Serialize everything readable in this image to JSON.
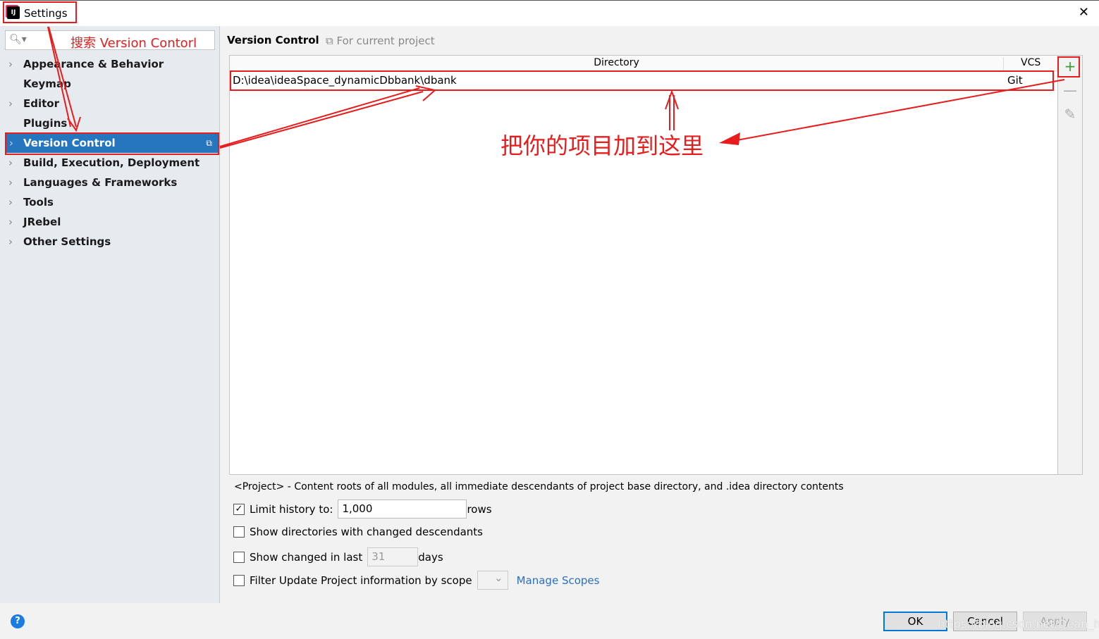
{
  "window": {
    "title": "Settings",
    "close": "✕"
  },
  "sidebar": {
    "search_placeholder": "搜索  Version Contorl",
    "items": [
      {
        "label": "Appearance & Behavior",
        "chev": "›"
      },
      {
        "label": "Keymap",
        "chev": ""
      },
      {
        "label": "Editor",
        "chev": "›"
      },
      {
        "label": "Plugins",
        "chev": ""
      },
      {
        "label": "Version Control",
        "chev": "›",
        "selected": true
      },
      {
        "label": "Build, Execution, Deployment",
        "chev": "›"
      },
      {
        "label": "Languages & Frameworks",
        "chev": "›"
      },
      {
        "label": "Tools",
        "chev": "›"
      },
      {
        "label": "JRebel",
        "chev": "›"
      },
      {
        "label": "Other Settings",
        "chev": "›"
      }
    ]
  },
  "main": {
    "title": "Version Control",
    "scope": "⧉ For current project",
    "table": {
      "headers": [
        "Directory",
        "VCS"
      ],
      "rows": [
        {
          "directory": "D:\\idea\\ideaSpace_dynamicDbbank\\dbank",
          "vcs": "Git"
        }
      ]
    },
    "tools": {
      "add": "+",
      "remove": "—",
      "edit": "✎"
    },
    "info": "<Project> - Content roots of all modules, all immediate descendants of project base directory, and .idea directory contents",
    "limit_history": {
      "label": "Limit history to:",
      "value": "1,000",
      "suffix": "rows",
      "checked": true
    },
    "show_dirs": {
      "label": "Show directories with changed descendants",
      "checked": false
    },
    "show_changed": {
      "label": "Show changed in last",
      "value": "31",
      "suffix": "days",
      "checked": false
    },
    "filter": {
      "label": "Filter Update Project information by scope",
      "link": "Manage Scopes",
      "checked": false
    }
  },
  "annotation": "把你的项目加到这里",
  "footer": {
    "help": "?",
    "ok": "OK",
    "cancel": "Cancel",
    "apply": "Apply",
    "watermark": "https://blog.csdn.net/Dean_hyh"
  },
  "colors": {
    "accent": "#2675bf",
    "annotation": "#e81c1c"
  }
}
